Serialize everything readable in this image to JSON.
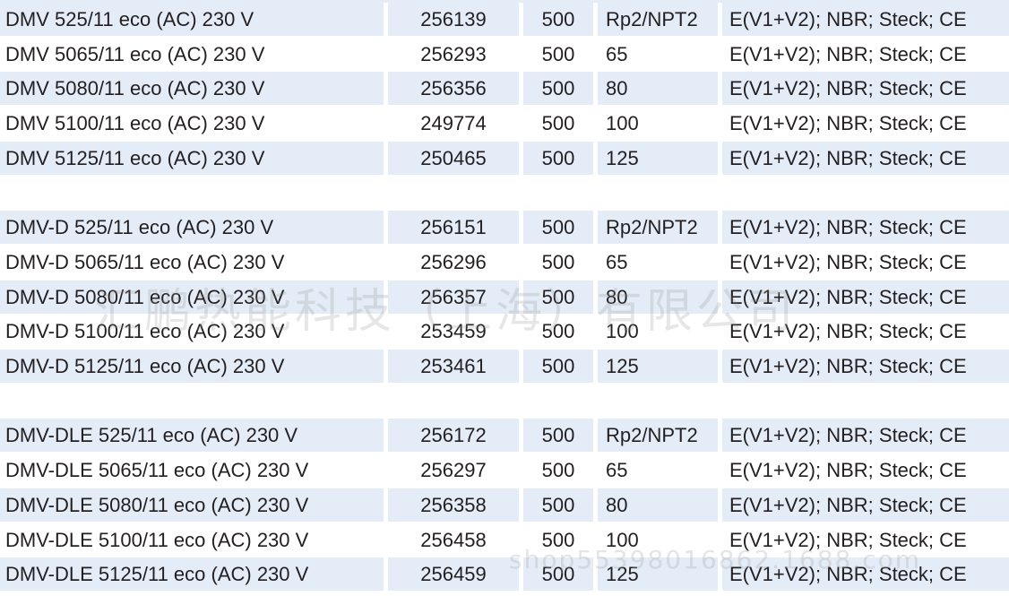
{
  "groups": [
    [
      {
        "name": "DMV 525/11 eco (AC) 230 V",
        "article": "256139",
        "pressure": "500",
        "size": "Rp2/NPT2",
        "spec": "E(V1+V2); NBR; Steck; CE"
      },
      {
        "name": "DMV 5065/11 eco (AC) 230 V",
        "article": "256293",
        "pressure": "500",
        "size": "65",
        "spec": "E(V1+V2); NBR; Steck; CE"
      },
      {
        "name": "DMV 5080/11 eco (AC) 230 V",
        "article": "256356",
        "pressure": "500",
        "size": "80",
        "spec": "E(V1+V2); NBR; Steck; CE"
      },
      {
        "name": "DMV 5100/11 eco (AC) 230 V",
        "article": "249774",
        "pressure": "500",
        "size": "100",
        "spec": "E(V1+V2); NBR; Steck; CE"
      },
      {
        "name": "DMV 5125/11 eco (AC) 230 V",
        "article": "250465",
        "pressure": "500",
        "size": "125",
        "spec": "E(V1+V2); NBR; Steck; CE"
      }
    ],
    [
      {
        "name": "DMV-D 525/11 eco (AC) 230 V",
        "article": "256151",
        "pressure": "500",
        "size": "Rp2/NPT2",
        "spec": "E(V1+V2); NBR; Steck; CE"
      },
      {
        "name": "DMV-D 5065/11 eco (AC) 230 V",
        "article": "256296",
        "pressure": "500",
        "size": "65",
        "spec": "E(V1+V2); NBR; Steck; CE"
      },
      {
        "name": "DMV-D 5080/11 eco (AC) 230 V",
        "article": "256357",
        "pressure": "500",
        "size": "80",
        "spec": "E(V1+V2); NBR; Steck; CE"
      },
      {
        "name": "DMV-D 5100/11 eco (AC) 230 V",
        "article": "253459",
        "pressure": "500",
        "size": "100",
        "spec": "E(V1+V2); NBR; Steck; CE"
      },
      {
        "name": "DMV-D 5125/11 eco (AC) 230 V",
        "article": "253461",
        "pressure": "500",
        "size": "125",
        "spec": "E(V1+V2); NBR; Steck; CE"
      }
    ],
    [
      {
        "name": "DMV-DLE 525/11 eco (AC) 230 V",
        "article": "256172",
        "pressure": "500",
        "size": "Rp2/NPT2",
        "spec": "E(V1+V2); NBR; Steck; CE"
      },
      {
        "name": "DMV-DLE 5065/11 eco (AC) 230 V",
        "article": "256297",
        "pressure": "500",
        "size": "65",
        "spec": "E(V1+V2); NBR; Steck; CE"
      },
      {
        "name": "DMV-DLE 5080/11 eco (AC) 230 V",
        "article": "256358",
        "pressure": "500",
        "size": "80",
        "spec": "E(V1+V2); NBR; Steck; CE"
      },
      {
        "name": "DMV-DLE 5100/11 eco (AC) 230 V",
        "article": "256458",
        "pressure": "500",
        "size": "100",
        "spec": "E(V1+V2); NBR; Steck; CE"
      },
      {
        "name": "DMV-DLE 5125/11 eco (AC) 230 V",
        "article": "256459",
        "pressure": "500",
        "size": "125",
        "spec": "E(V1+V2); NBR; Steck; CE"
      }
    ]
  ],
  "watermark": {
    "company": "汇鹏热能科技（上海）有限公司",
    "shop": "shop55398016862.1688.com"
  },
  "colors": {
    "row_shade": "#e4ecf7",
    "text": "#231f20"
  }
}
